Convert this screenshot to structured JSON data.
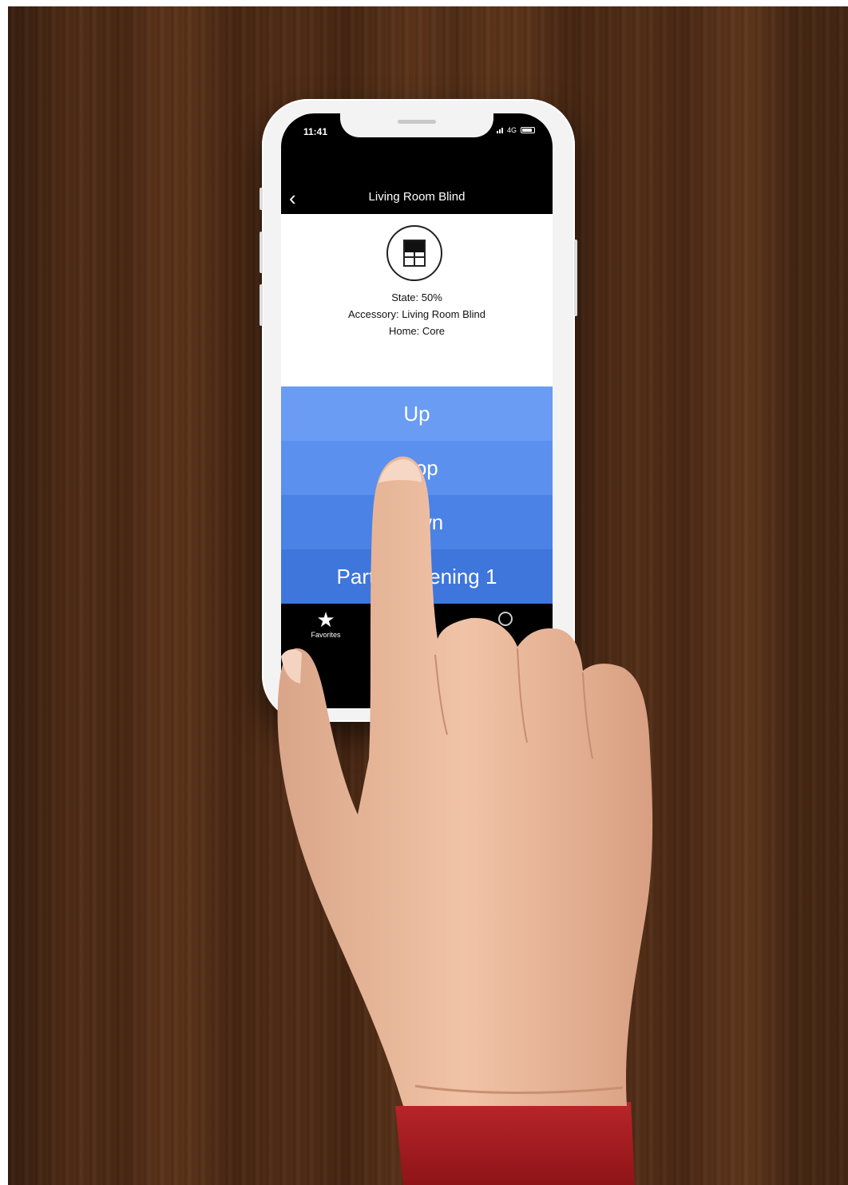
{
  "status_bar": {
    "time": "11:41",
    "network": "4G"
  },
  "nav": {
    "back_icon": "chevron-left-icon",
    "title": "Living Room Blind"
  },
  "accessory": {
    "icon": "window-blind-icon",
    "state": "State: 50%",
    "accessory": "Accessory: Living Room Blind",
    "home": "Home: Core"
  },
  "actions": [
    {
      "label": "Up",
      "color": "#6a9cf3"
    },
    {
      "label": "Stop",
      "color": "#5b90ee"
    },
    {
      "label": "Down",
      "color": "#4a82e6"
    },
    {
      "label": "Partial Opening 1",
      "color": "#3f76dc"
    }
  ],
  "tabbar": {
    "favorites_label": "Favorites",
    "favorites_icon": "star-icon"
  }
}
